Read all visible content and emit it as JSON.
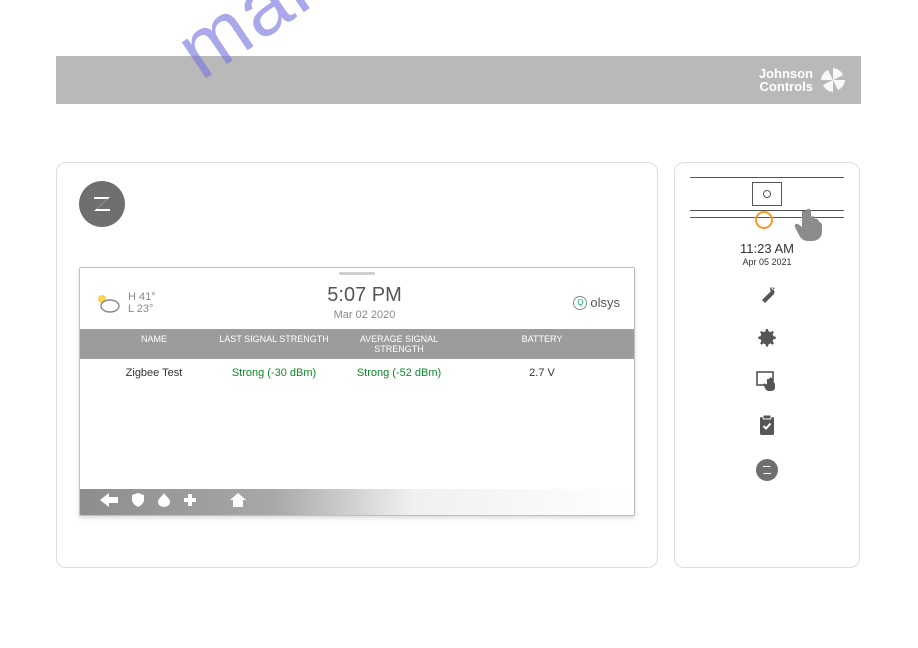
{
  "banner": {
    "brand_line1": "Johnson",
    "brand_line2": "Controls"
  },
  "watermark": "manualshive.com",
  "main_screen": {
    "weather_high": "H 41°",
    "weather_low": "L 23°",
    "time": "5:07 PM",
    "date": "Mar 02 2020",
    "brand": "olsys",
    "columns": {
      "name": "NAME",
      "last": "LAST SIGNAL STRENGTH",
      "avg": "AVERAGE SIGNAL STRENGTH",
      "bat": "BATTERY"
    },
    "rows": [
      {
        "name": "Zigbee Test",
        "last": "Strong (-30 dBm)",
        "avg": "Strong (-52 dBm)",
        "bat": "2.7 V"
      }
    ]
  },
  "side": {
    "time": "11:23 AM",
    "date": "Apr 05 2021"
  }
}
